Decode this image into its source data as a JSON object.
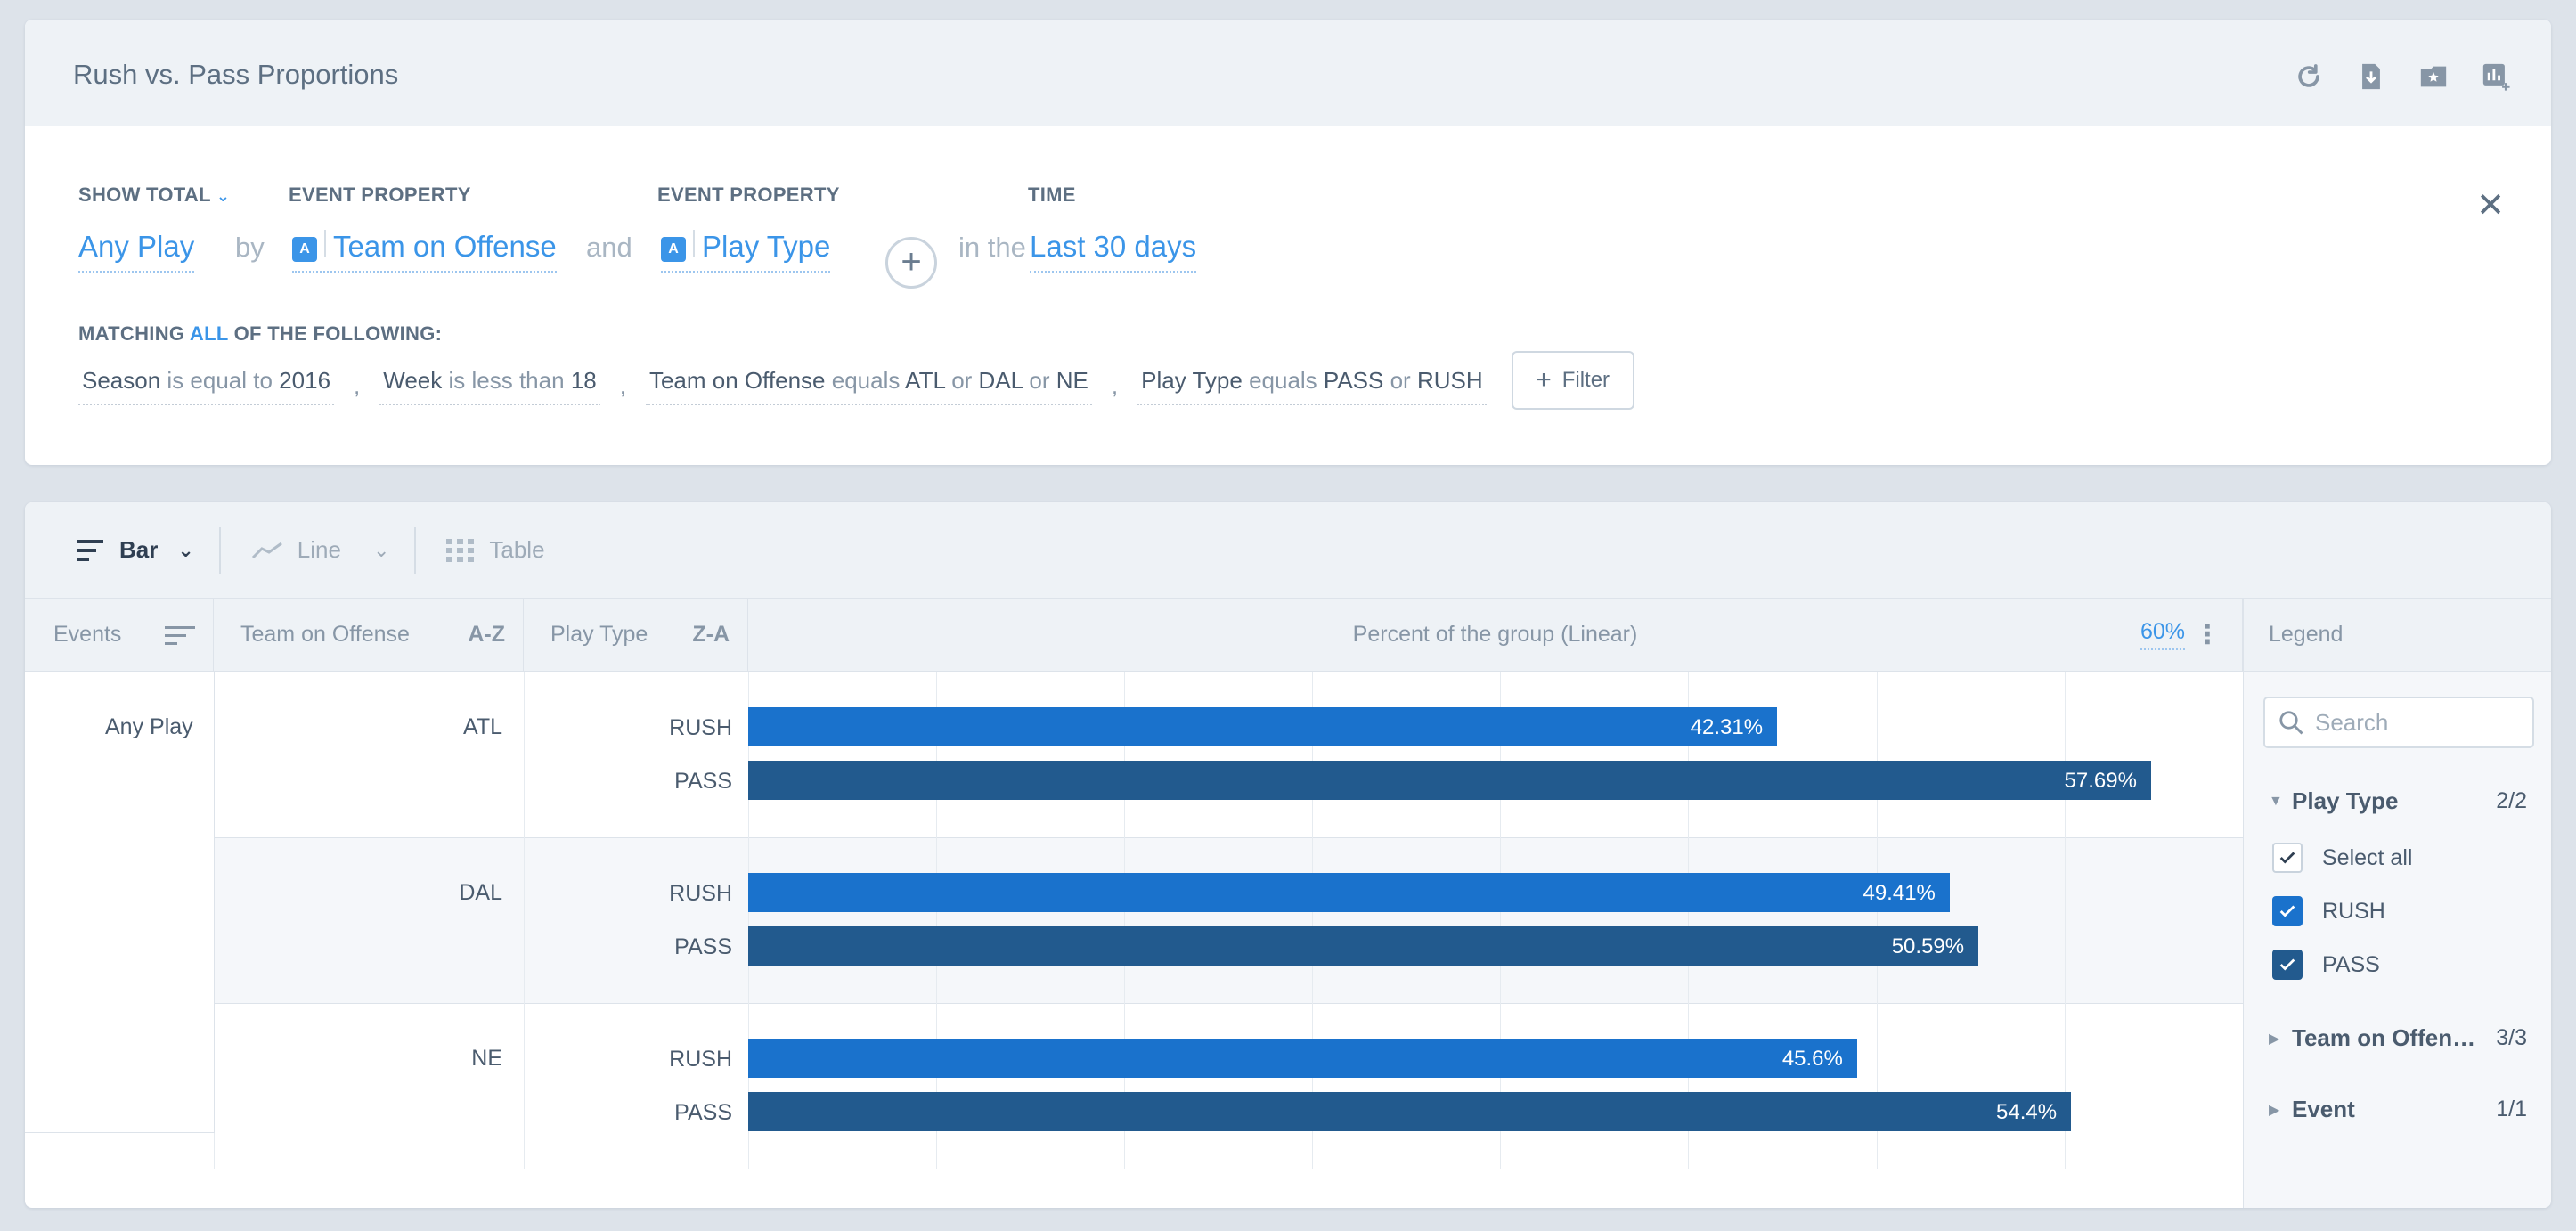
{
  "report": {
    "title": "Rush vs. Pass Proportions"
  },
  "header_icons": [
    "refresh-icon",
    "download-icon",
    "bookmark-star-icon",
    "add-to-dashboard-icon"
  ],
  "query": {
    "show_total_label": "SHOW TOTAL",
    "event": "Any Play",
    "by_label": "by",
    "prop1_label": "EVENT PROPERTY",
    "prop1_badge": "A",
    "prop1": "Team on Offense",
    "and_label": "and",
    "prop2_label": "EVENT PROPERTY",
    "prop2_badge": "A",
    "prop2": "Play Type",
    "in_the_label": "in the",
    "time_label": "TIME",
    "time": "Last 30 days",
    "matching_prefix": "MATCHING",
    "matching_all": "ALL",
    "matching_suffix": "OF THE FOLLOWING:",
    "filters": [
      {
        "p": "Season",
        "op": "is equal to",
        "v": "2016"
      },
      {
        "p": "Week",
        "op": "is less than",
        "v": "18"
      },
      {
        "p": "Team on Offense",
        "op": "equals",
        "v1": "ATL",
        "or1": "or",
        "v2": "DAL",
        "or2": "or",
        "v3": "NE"
      },
      {
        "p": "Play Type",
        "op": "equals",
        "v1": "PASS",
        "or1": "or",
        "v2": "RUSH"
      }
    ],
    "filter_sep": ",",
    "filter_button": "Filter"
  },
  "vis": {
    "bar": "Bar",
    "line": "Line",
    "table": "Table"
  },
  "columns": {
    "events": "Events",
    "team": "Team on Offense",
    "team_sort": "A-Z",
    "play_type": "Play Type",
    "play_sort": "Z-A",
    "metric": "Percent of the group (Linear)",
    "max_label": "60%"
  },
  "colors": {
    "rush": "#1a72cc",
    "pass": "#225a8e"
  },
  "chart_data": {
    "type": "bar",
    "orientation": "horizontal",
    "xlim": [
      0,
      60
    ],
    "event": "Any Play",
    "groups": [
      {
        "team": "ATL",
        "bars": [
          {
            "play": "RUSH",
            "value": 42.31,
            "label": "42.31%"
          },
          {
            "play": "PASS",
            "value": 57.69,
            "label": "57.69%"
          }
        ]
      },
      {
        "team": "DAL",
        "bars": [
          {
            "play": "RUSH",
            "value": 49.41,
            "label": "49.41%"
          },
          {
            "play": "PASS",
            "value": 50.59,
            "label": "50.59%"
          }
        ]
      },
      {
        "team": "NE",
        "bars": [
          {
            "play": "RUSH",
            "value": 45.6,
            "label": "45.6%"
          },
          {
            "play": "PASS",
            "value": 54.4,
            "label": "54.4%"
          }
        ]
      }
    ]
  },
  "legend": {
    "title": "Legend",
    "search_placeholder": "Search",
    "play_type": {
      "label": "Play Type",
      "count": "2/2"
    },
    "select_all": "Select all",
    "rush": "RUSH",
    "pass": "PASS",
    "team": {
      "label": "Team on Offen…",
      "count": "3/3"
    },
    "event": {
      "label": "Event",
      "count": "1/1"
    }
  }
}
